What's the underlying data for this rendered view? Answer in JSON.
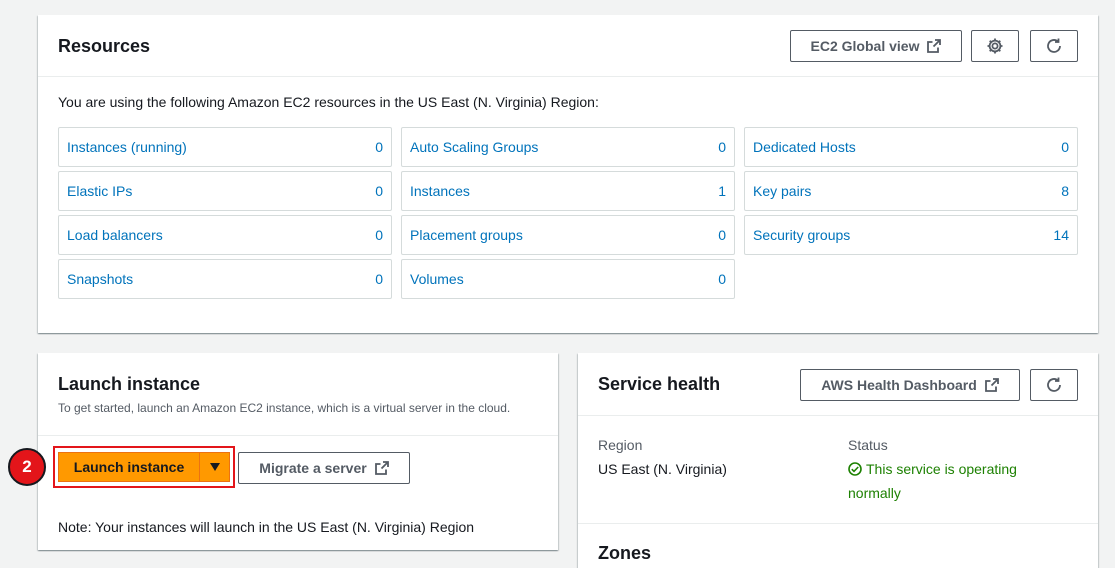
{
  "resources": {
    "title": "Resources",
    "global_view_label": "EC2 Global view",
    "intro_text": "You are using the following Amazon EC2 resources in the US East (N. Virginia) Region:",
    "tiles": [
      {
        "name": "Instances (running)",
        "count": "0"
      },
      {
        "name": "Auto Scaling Groups",
        "count": "0"
      },
      {
        "name": "Dedicated Hosts",
        "count": "0"
      },
      {
        "name": "Elastic IPs",
        "count": "0"
      },
      {
        "name": "Instances",
        "count": "1"
      },
      {
        "name": "Key pairs",
        "count": "8"
      },
      {
        "name": "Load balancers",
        "count": "0"
      },
      {
        "name": "Placement groups",
        "count": "0"
      },
      {
        "name": "Security groups",
        "count": "14"
      },
      {
        "name": "Snapshots",
        "count": "0"
      },
      {
        "name": "Volumes",
        "count": "0"
      }
    ]
  },
  "launch": {
    "title": "Launch instance",
    "subtitle": "To get started, launch an Amazon EC2 instance, which is a virtual server in the cloud.",
    "launch_label": "Launch instance",
    "migrate_label": "Migrate a server",
    "note": "Note: Your instances will launch in the US East (N. Virginia) Region",
    "step_number": "2"
  },
  "health": {
    "title": "Service health",
    "dashboard_label": "AWS Health Dashboard",
    "region_label": "Region",
    "region_value": "US East (N. Virginia)",
    "status_label": "Status",
    "status_value": "This service is operating normally",
    "zones_title": "Zones"
  },
  "colors": {
    "background": "#f2f3f3",
    "link": "#0073bb",
    "primary_button": "#ff9900",
    "status_ok": "#1d8102",
    "highlight": "#e3151a"
  },
  "icons": [
    "external-link-icon",
    "gear-icon",
    "refresh-icon",
    "caret-down-icon",
    "check-circle-icon"
  ]
}
